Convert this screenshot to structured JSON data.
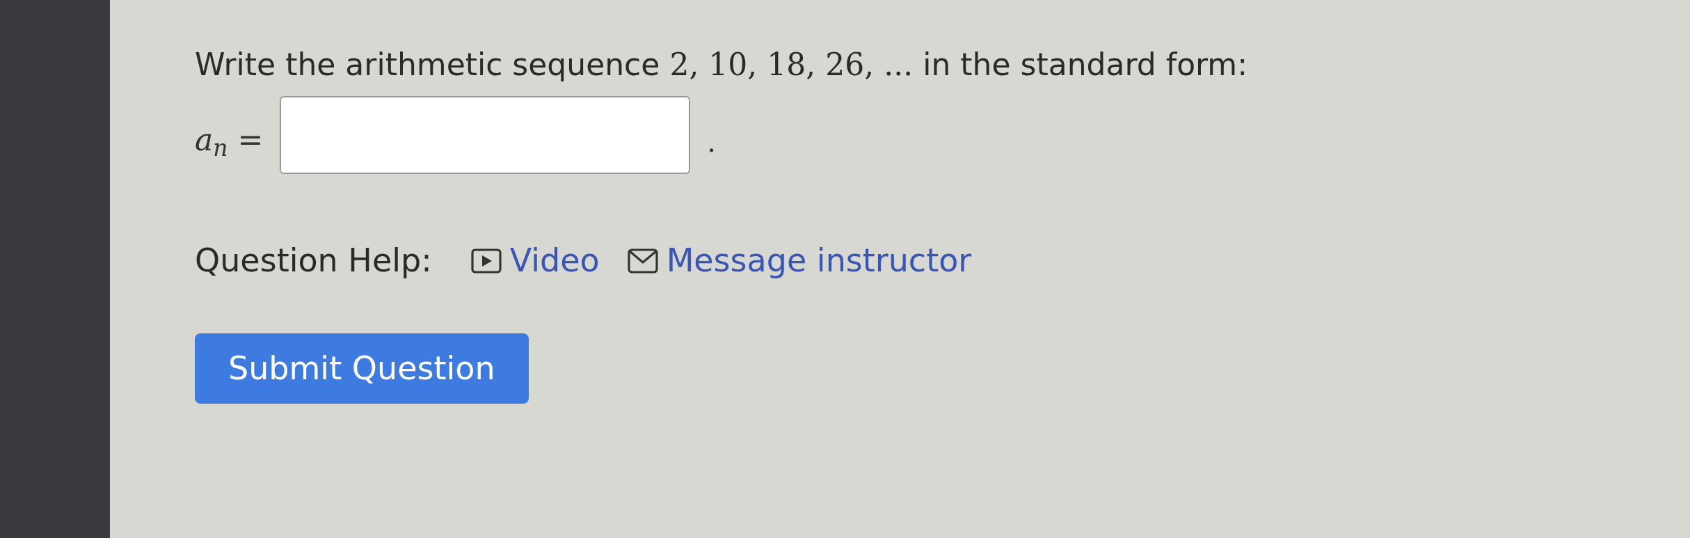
{
  "question": {
    "text_before": "Write the arithmetic sequence",
    "sequence": "2, 10, 18, 26, ...",
    "text_after": "in the standard form:"
  },
  "answer": {
    "label": "a$_{n}$ =",
    "trailing": "."
  },
  "help": {
    "label": "Question Help:",
    "links": [
      {
        "kind": "video",
        "label": "Video"
      },
      {
        "kind": "message",
        "label": "Message instructor"
      }
    ]
  },
  "submit": {
    "label": "Submit Question"
  }
}
